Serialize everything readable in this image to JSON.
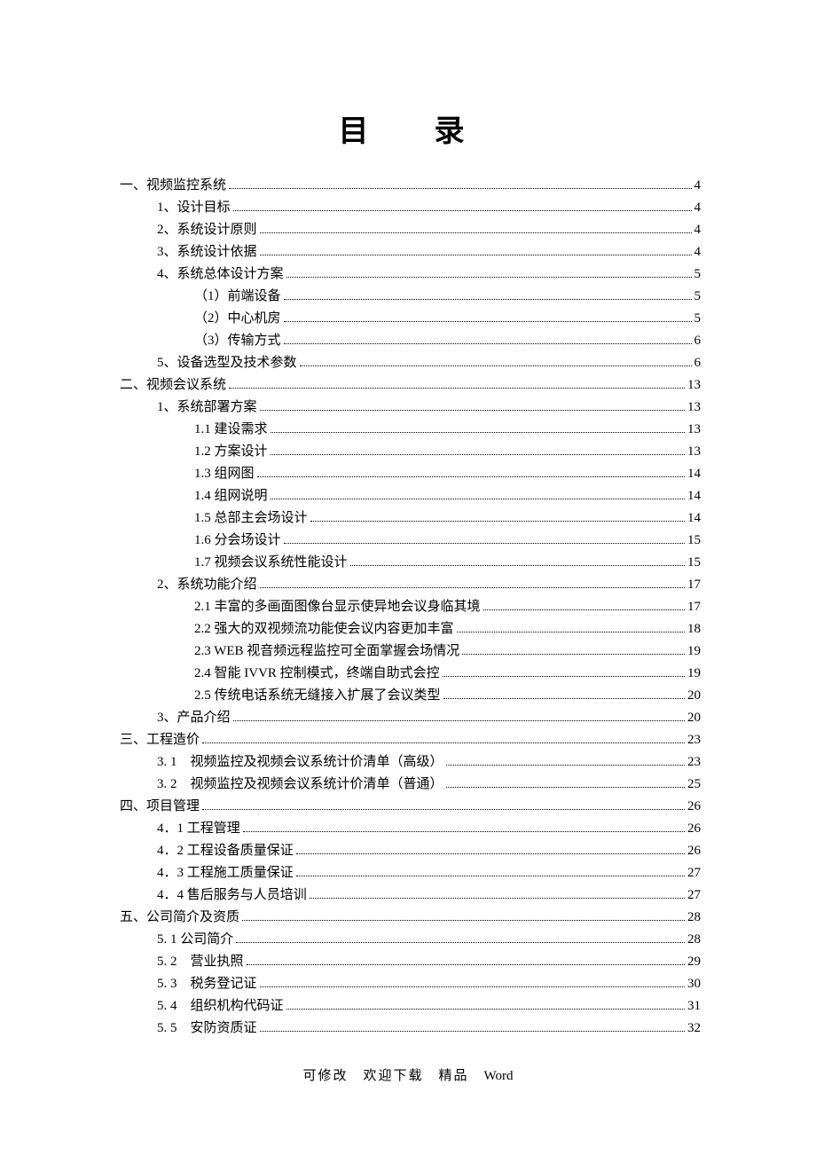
{
  "title": "目　录",
  "footer": {
    "zh": "可修改　欢迎下载　精品　",
    "en": "Word"
  },
  "toc": [
    {
      "level": 0,
      "label": "一、视频监控系统",
      "page": "4"
    },
    {
      "level": 1,
      "label": "1、设计目标",
      "page": "4"
    },
    {
      "level": 1,
      "label": "2、系统设计原则",
      "page": "4"
    },
    {
      "level": 1,
      "label": "3、系统设计依据",
      "page": "4"
    },
    {
      "level": 1,
      "label": "4、系统总体设计方案",
      "page": "5"
    },
    {
      "level": 2,
      "label": "（1）前端设备",
      "page": "5"
    },
    {
      "level": 2,
      "label": "（2）中心机房",
      "page": "5"
    },
    {
      "level": 2,
      "label": "（3）传输方式",
      "page": "6"
    },
    {
      "level": 1,
      "label": "5、设备选型及技术参数",
      "page": "6"
    },
    {
      "level": 0,
      "label": "二、视频会议系统",
      "page": "13"
    },
    {
      "level": 1,
      "label": "1、系统部署方案",
      "page": "13"
    },
    {
      "level": 2,
      "label": "1.1 建设需求",
      "page": "13"
    },
    {
      "level": 2,
      "label": "1.2 方案设计",
      "page": "13"
    },
    {
      "level": 2,
      "label": "1.3 组网图",
      "page": "14"
    },
    {
      "level": 2,
      "label": "1.4 组网说明",
      "page": "14"
    },
    {
      "level": 2,
      "label": "1.5 总部主会场设计",
      "page": "14"
    },
    {
      "level": 2,
      "label": "1.6 分会场设计",
      "page": "15"
    },
    {
      "level": 2,
      "label": "1.7 视频会议系统性能设计",
      "page": "15"
    },
    {
      "level": 1,
      "label": "2、系统功能介绍",
      "page": "17"
    },
    {
      "level": 2,
      "label": "2.1 丰富的多画面图像台显示使异地会议身临其境",
      "page": "17"
    },
    {
      "level": 2,
      "label": "2.2 强大的双视频流功能使会议内容更加丰富",
      "page": "18"
    },
    {
      "level": 2,
      "label": "2.3 WEB 视音频远程监控可全面掌握会场情况",
      "page": "19"
    },
    {
      "level": 2,
      "label": "2.4 智能 IVVR 控制模式，终端自助式会控",
      "page": "19"
    },
    {
      "level": 2,
      "label": "2.5 传统电话系统无缝接入扩展了会议类型",
      "page": "20"
    },
    {
      "level": 1,
      "label": "3、产品介绍",
      "page": "20"
    },
    {
      "level": 0,
      "label": "三、工程造价",
      "page": "23"
    },
    {
      "level": 1,
      "label": "3. 1　视频监控及视频会议系统计价清单（高级）",
      "page": "23"
    },
    {
      "level": 1,
      "label": "3. 2　视频监控及视频会议系统计价清单（普通）",
      "page": "25"
    },
    {
      "level": 0,
      "label": "四、项目管理",
      "page": "26"
    },
    {
      "level": 1,
      "label": "4．1 工程管理",
      "page": "26"
    },
    {
      "level": 1,
      "label": "4．2 工程设备质量保证",
      "page": "26"
    },
    {
      "level": 1,
      "label": "4．3 工程施工质量保证",
      "page": "27"
    },
    {
      "level": 1,
      "label": "4．4 售后服务与人员培训",
      "page": "27"
    },
    {
      "level": 0,
      "label": "五、公司简介及资质",
      "page": "28"
    },
    {
      "level": 1,
      "label": "5. 1 公司简介",
      "page": "28"
    },
    {
      "level": 1,
      "label": "5. 2　营业执照",
      "page": "29"
    },
    {
      "level": 1,
      "label": "5. 3　税务登记证",
      "page": "30"
    },
    {
      "level": 1,
      "label": "5. 4　组织机构代码证",
      "page": "31"
    },
    {
      "level": 1,
      "label": "5. 5　安防资质证",
      "page": "32"
    }
  ]
}
